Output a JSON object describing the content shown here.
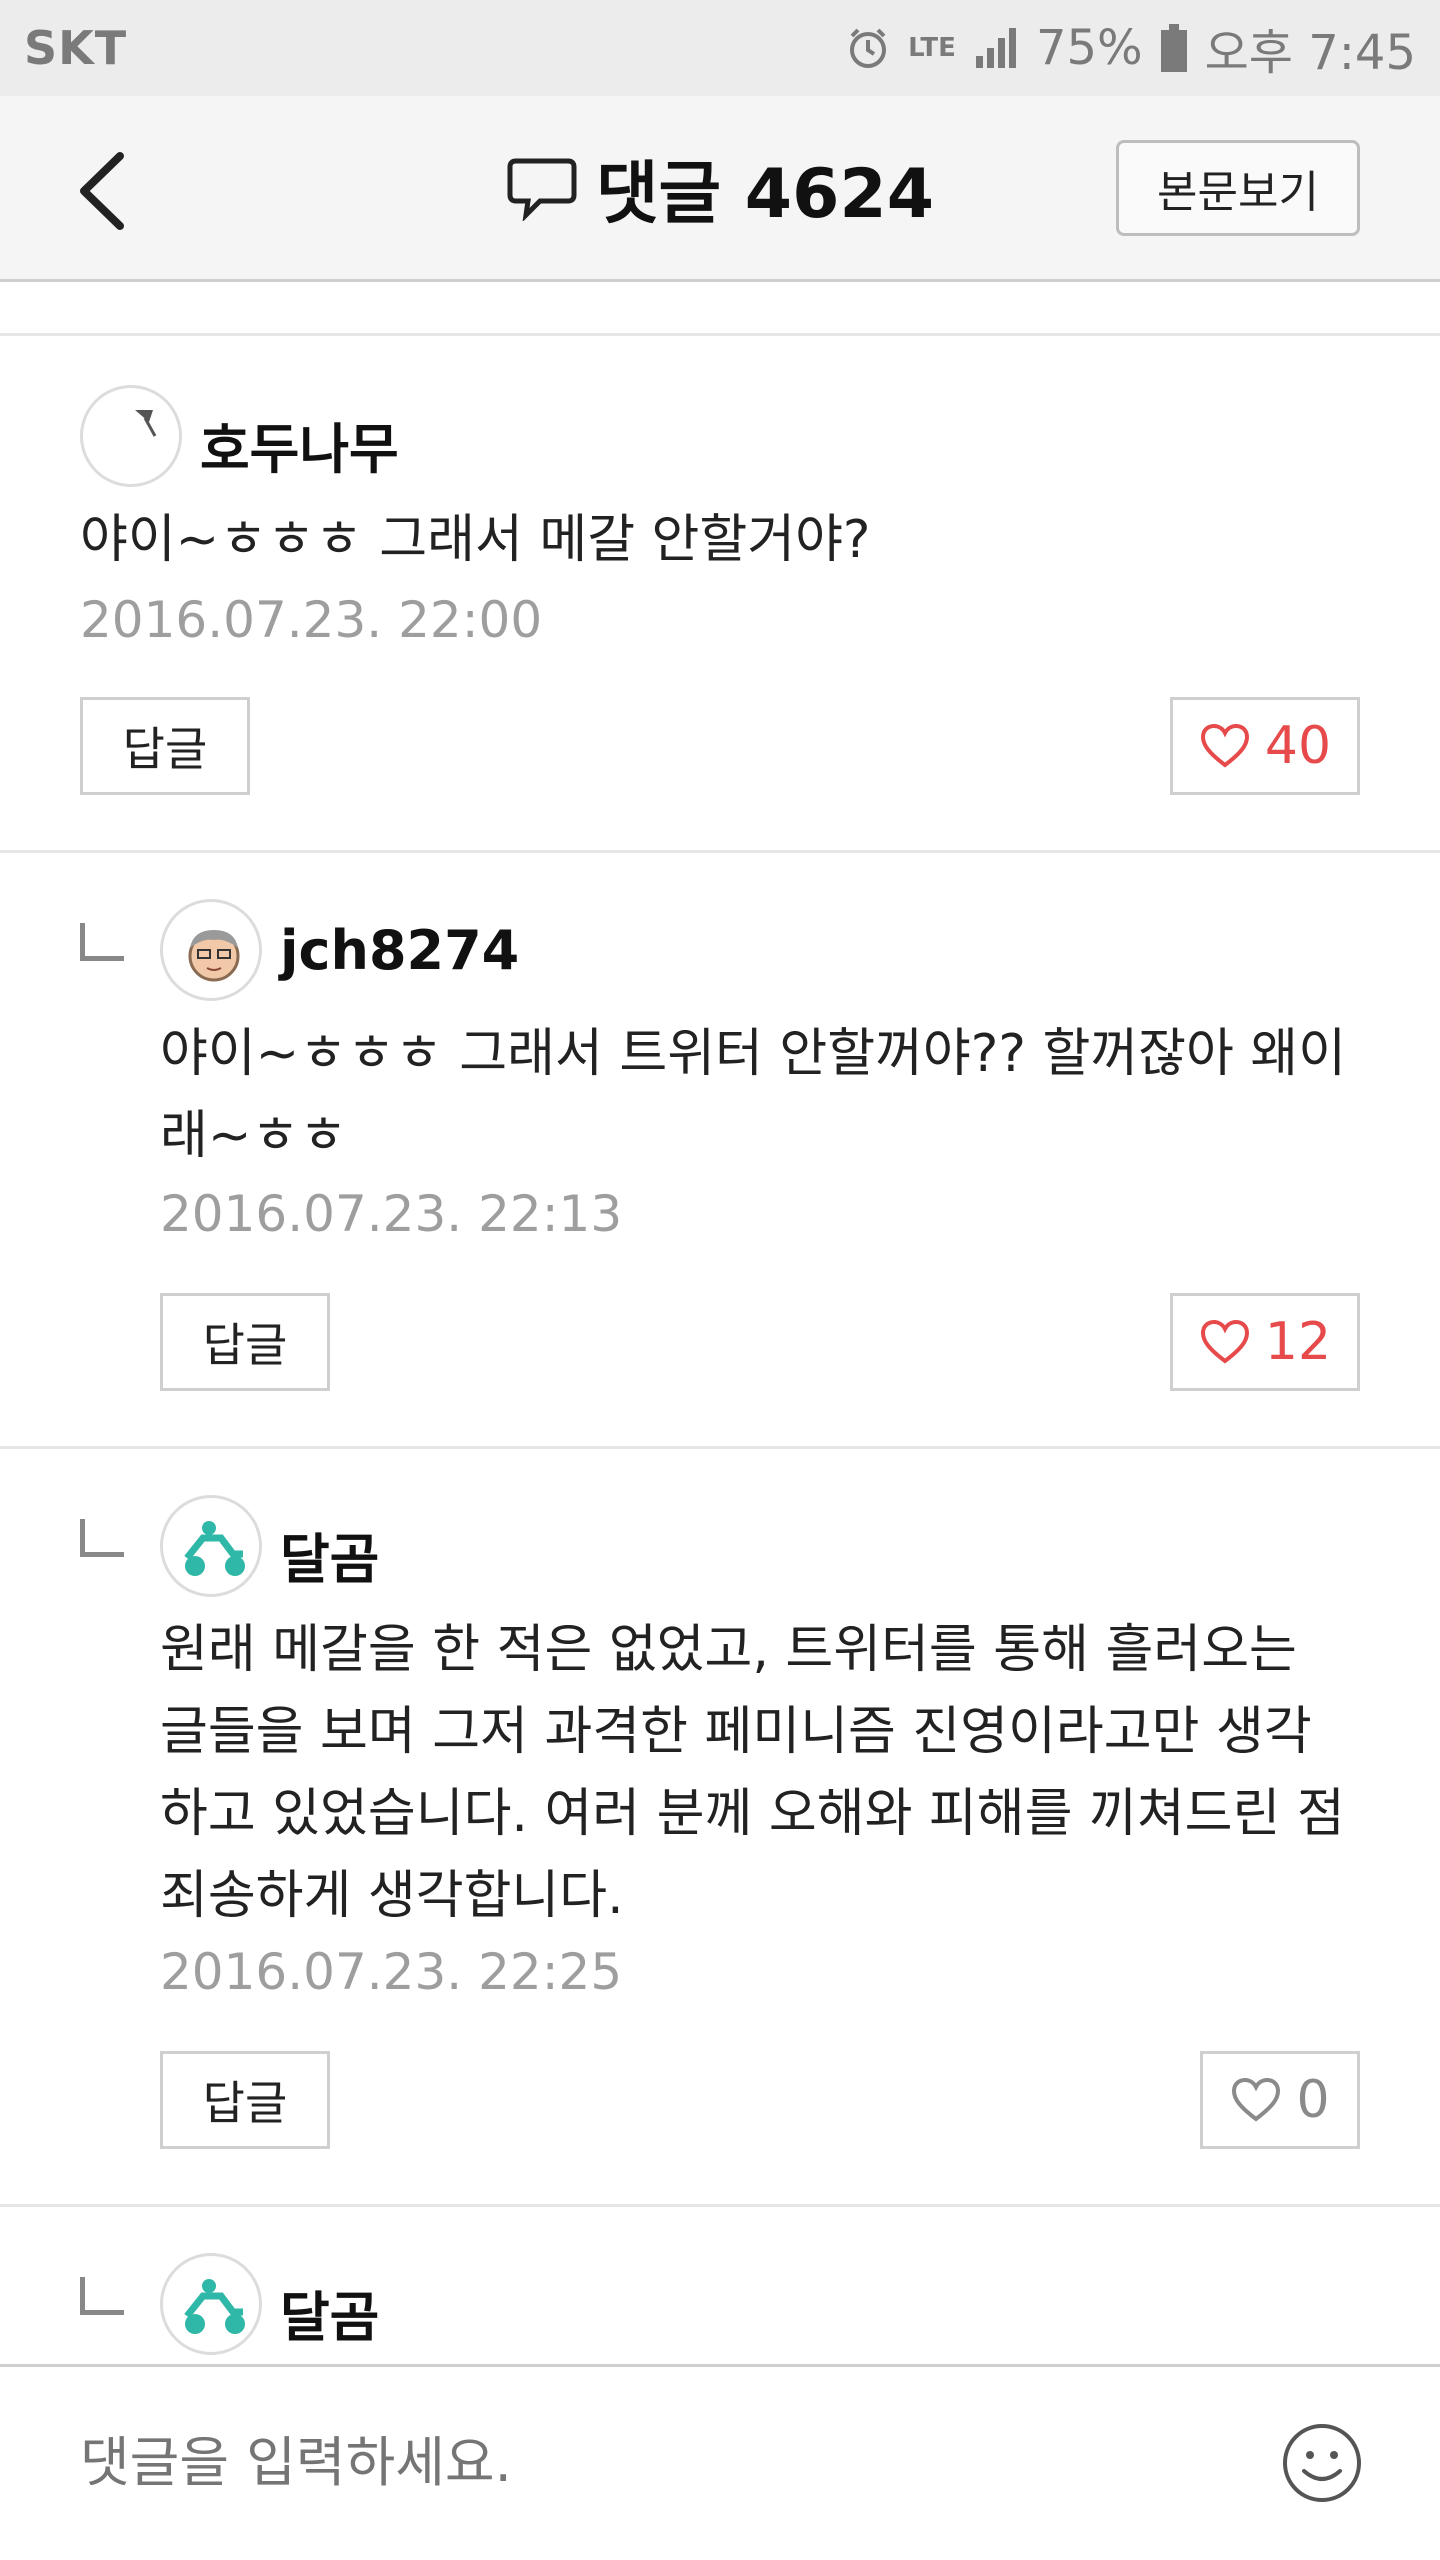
{
  "status_bar": {
    "carrier": "SKT",
    "network": "LTE",
    "battery": "75%",
    "time": "오후 7:45"
  },
  "header": {
    "title": "댓글 4624",
    "view_body_label": "본문보기"
  },
  "comments": [
    {
      "username": "호두나무",
      "text": "야이~ㅎㅎㅎ 그래서 메갈 안할거야?",
      "date": "2016.07.23. 22:00",
      "reply_label": "답글",
      "likes": "40",
      "is_reply": false
    },
    {
      "username": "jch8274",
      "text": "야이~ㅎㅎㅎ 그래서 트위터 안할꺼야?? 할꺼잖아 왜이래~ㅎㅎ",
      "date": "2016.07.23. 22:13",
      "reply_label": "답글",
      "likes": "12",
      "is_reply": true
    },
    {
      "username": "달곰",
      "text": "원래 메갈을 한 적은 없었고, 트위터를 통해 흘러오는 글들을 보며 그저 과격한 페미니즘 진영이라고만 생각하고 있었습니다. 여러 분께 오해와 피해를 끼쳐드린 점 죄송하게 생각합니다.",
      "date": "2016.07.23. 22:25",
      "reply_label": "답글",
      "likes": "0",
      "is_reply": true
    },
    {
      "username": "달곰",
      "is_reply": true
    }
  ],
  "input": {
    "placeholder": "댓글을 입력하세요."
  },
  "colors": {
    "like_active": "#e64a4a",
    "like_inactive": "#8a8a8a"
  }
}
